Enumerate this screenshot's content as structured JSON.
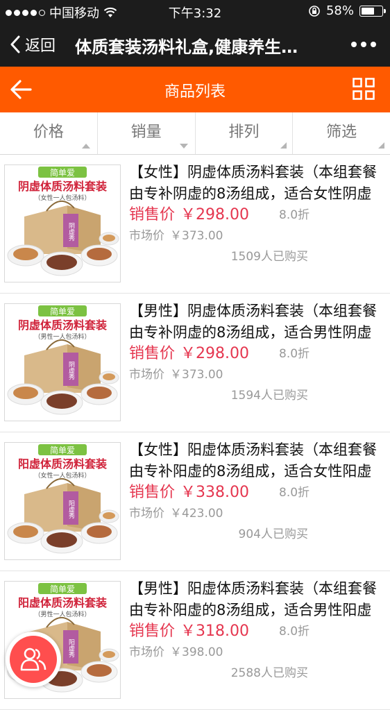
{
  "status": {
    "carrier": "中国移动",
    "time": "下午3:32",
    "battery": "58%",
    "battery_level": 0.58
  },
  "nav": {
    "back_label": "返回",
    "title": "体质套装汤料礼盒,健康养生…"
  },
  "header": {
    "title": "商品列表"
  },
  "tabs": [
    {
      "label": "价格",
      "indicator": "up"
    },
    {
      "label": "销量",
      "indicator": "down"
    },
    {
      "label": "排列",
      "indicator": "corner"
    },
    {
      "label": "筛选",
      "indicator": "corner"
    }
  ],
  "products": [
    {
      "title": "【女性】阴虚体质汤料套装（本组套餐由专补阴虚的8汤组成，适合女性阴虚",
      "sale_label": "销售价",
      "price": "￥298.00",
      "discount": "8.0折",
      "market_label": "市场价",
      "market_price": "￥373.00",
      "bought": "1509人已购买",
      "thumb": {
        "brand": "简单爱",
        "name": "阴虚体质汤料套装",
        "sub": "（女性一人包汤料）",
        "box_label": "阴虚秀"
      }
    },
    {
      "title": "【男性】阴虚体质汤料套装（本组套餐由专补阴虚的8汤组成，适合男性阴虚",
      "sale_label": "销售价",
      "price": "￥298.00",
      "discount": "8.0折",
      "market_label": "市场价",
      "market_price": "￥373.00",
      "bought": "1594人已购买",
      "thumb": {
        "brand": "简单爱",
        "name": "阴虚体质汤料套装",
        "sub": "（男性一人包汤料）",
        "box_label": "阴虚秀"
      }
    },
    {
      "title": "【女性】阳虚体质汤料套装（本组套餐由专补阳虚的8汤组成，适合女性阳虚",
      "sale_label": "销售价",
      "price": "￥338.00",
      "discount": "8.0折",
      "market_label": "市场价",
      "market_price": "￥423.00",
      "bought": "904人已购买",
      "thumb": {
        "brand": "简单爱",
        "name": "阳虚体质汤料套装",
        "sub": "（女性一人包汤料）",
        "box_label": "阳虚秀"
      }
    },
    {
      "title": "【男性】阳虚体质汤料套装（本组套餐由专补阳虚的8汤组成，适合男性阳虚",
      "sale_label": "销售价",
      "price": "￥318.00",
      "discount": "8.0折",
      "market_label": "市场价",
      "market_price": "￥398.00",
      "bought": "2588人已购买",
      "thumb": {
        "brand": "简单爱",
        "name": "阳虚体质汤料套装",
        "sub": "（男性一人包汤料）",
        "box_label": "阳虚秀"
      }
    }
  ],
  "colors": {
    "accent": "#ff5a00",
    "price": "#e5364f",
    "muted": "#999999",
    "fab": "#ff4e4e"
  },
  "icons": {
    "back": "chevron-left-icon",
    "header_back": "arrow-left-icon",
    "view_toggle": "grid-icon",
    "more": "more-icon",
    "fab": "people-icon"
  }
}
